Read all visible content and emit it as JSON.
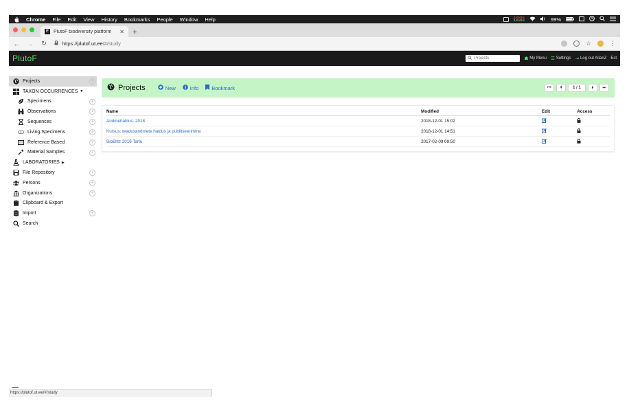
{
  "menubar": {
    "app": "Chrome",
    "items": [
      "File",
      "Edit",
      "View",
      "History",
      "Bookmarks",
      "People",
      "Window",
      "Help"
    ],
    "net_up": "4,8 kB/s",
    "net_down": "3,8 kB/s",
    "battery": "99%"
  },
  "browser": {
    "tab_title": "PlutoF biodiversity platform",
    "tab_favicon": "F",
    "url_scheme": "https://",
    "url_domain": "plutof.ut.ee",
    "url_path": "/#/study",
    "status_url": "https://plutof.ut.ee/#/study"
  },
  "header": {
    "logo": "PlutoF",
    "search_placeholder": "Projects",
    "my_menu": "My Menu",
    "settings": "Settings",
    "logout": "Log out AllanZ",
    "language": "Est"
  },
  "sidebar": {
    "items": [
      {
        "label": "Projects",
        "icon": "globe-icon",
        "active": true,
        "add": true,
        "sub": false
      },
      {
        "label": "TAXON OCCURRENCES",
        "icon": "grid-icon",
        "caret": "down",
        "sub": false
      },
      {
        "label": "Specimens",
        "icon": "leaf-icon",
        "add": true,
        "sub": true
      },
      {
        "label": "Observations",
        "icon": "binoculars-icon",
        "add": true,
        "sub": true
      },
      {
        "label": "Sequences",
        "icon": "hourglass-icon",
        "add": true,
        "sub": true
      },
      {
        "label": "Living Specimens",
        "icon": "capsule-icon",
        "add": true,
        "sub": true
      },
      {
        "label": "Reference Based",
        "icon": "book-icon",
        "add": true,
        "sub": true
      },
      {
        "label": "Material Samples",
        "icon": "dropper-icon",
        "add": true,
        "sub": true
      },
      {
        "label": "LABORATORIES",
        "icon": "flask-icon",
        "caret": "right",
        "sub": false
      },
      {
        "label": "File Repository",
        "icon": "floppy-icon",
        "add": true,
        "sub": false
      },
      {
        "label": "Persons",
        "icon": "people-icon",
        "add": true,
        "sub": false
      },
      {
        "label": "Organizations",
        "icon": "institution-icon",
        "add": true,
        "sub": false
      },
      {
        "label": "Clipboard & Export",
        "icon": "clipboard-icon",
        "sub": false
      },
      {
        "label": "Import",
        "icon": "database-icon",
        "add": true,
        "sub": false
      },
      {
        "label": "Search",
        "icon": "search-icon",
        "sub": false
      }
    ]
  },
  "panel": {
    "title": "Projects",
    "new_label": "New",
    "info_label": "Info",
    "bookmark_label": "Bookmark",
    "page_counter": "1 / 1"
  },
  "table": {
    "columns": [
      "Name",
      "Modified",
      "Edit",
      "Access"
    ],
    "rows": [
      {
        "name": "Andmehaldus: 2018",
        "modified": "2018-12-01 15:02"
      },
      {
        "name": "Kursus: teadusandmete haldus ja publitseerimine",
        "modified": "2018-12-01 14:51"
      },
      {
        "name": "BioBlitz 2016 Tartu",
        "modified": "2017-02-09 09:50"
      }
    ]
  },
  "colors": {
    "accent_green": "#5bd86a",
    "panel_green": "#c5f5c7",
    "link_blue": "#2a6dbb"
  }
}
